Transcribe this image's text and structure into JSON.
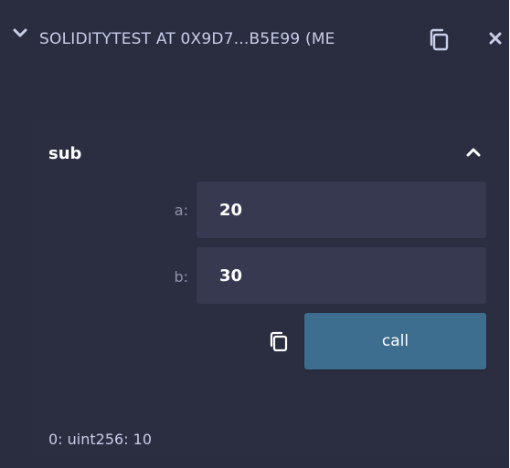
{
  "instance": {
    "title": "SOLIDITYTEST AT 0X9D7...B5E99 (ME",
    "icons": {
      "collapse": "chevron-down-icon",
      "copy": "copy-icon",
      "close": "close-icon"
    }
  },
  "function": {
    "name": "sub",
    "collapse_icon": "chevron-up-icon",
    "params": [
      {
        "label": "a:",
        "value": "20"
      },
      {
        "label": "b:",
        "value": "30"
      }
    ],
    "copy_icon": "copy-icon",
    "call_label": "call",
    "result": "0: uint256: 10"
  },
  "colors": {
    "panel_bg": "#2a2c3f",
    "field_bg": "#363950",
    "button_bg": "#3e6e8f",
    "text": "#c8cde8",
    "label": "#8f93ad"
  }
}
